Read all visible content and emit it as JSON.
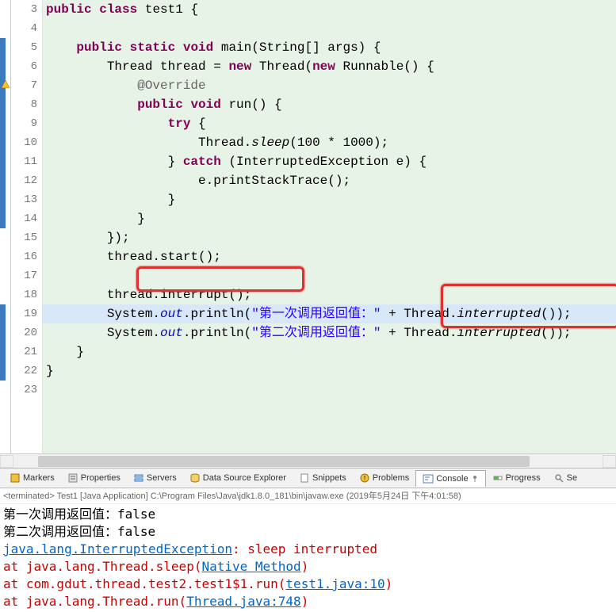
{
  "editor": {
    "lines": [
      {
        "num": 3,
        "tokens": [
          {
            "t": "public",
            "c": "kw"
          },
          {
            "t": " ",
            "c": "plain"
          },
          {
            "t": "class",
            "c": "kw"
          },
          {
            "t": " test1 {",
            "c": "plain"
          }
        ]
      },
      {
        "num": 4,
        "tokens": []
      },
      {
        "num": 5,
        "tokens": [
          {
            "t": "    ",
            "c": "plain"
          },
          {
            "t": "public",
            "c": "kw"
          },
          {
            "t": " ",
            "c": "plain"
          },
          {
            "t": "static",
            "c": "kw"
          },
          {
            "t": " ",
            "c": "plain"
          },
          {
            "t": "void",
            "c": "kw"
          },
          {
            "t": " main(String[] args) {",
            "c": "plain"
          }
        ]
      },
      {
        "num": 6,
        "tokens": [
          {
            "t": "        Thread thread = ",
            "c": "plain"
          },
          {
            "t": "new",
            "c": "kw"
          },
          {
            "t": " Thread(",
            "c": "plain"
          },
          {
            "t": "new",
            "c": "kw"
          },
          {
            "t": " Runnable() {",
            "c": "plain"
          }
        ]
      },
      {
        "num": 7,
        "tokens": [
          {
            "t": "            ",
            "c": "plain"
          },
          {
            "t": "@Override",
            "c": "ann"
          }
        ]
      },
      {
        "num": 8,
        "tokens": [
          {
            "t": "            ",
            "c": "plain"
          },
          {
            "t": "public",
            "c": "kw"
          },
          {
            "t": " ",
            "c": "plain"
          },
          {
            "t": "void",
            "c": "kw"
          },
          {
            "t": " run() {",
            "c": "plain"
          }
        ]
      },
      {
        "num": 9,
        "tokens": [
          {
            "t": "                ",
            "c": "plain"
          },
          {
            "t": "try",
            "c": "kw"
          },
          {
            "t": " {",
            "c": "plain"
          }
        ]
      },
      {
        "num": 10,
        "tokens": [
          {
            "t": "                    Thread.",
            "c": "plain"
          },
          {
            "t": "sleep",
            "c": "method-static"
          },
          {
            "t": "(100 * 1000);",
            "c": "plain"
          }
        ]
      },
      {
        "num": 11,
        "tokens": [
          {
            "t": "                } ",
            "c": "plain"
          },
          {
            "t": "catch",
            "c": "kw"
          },
          {
            "t": " (InterruptedException e) {",
            "c": "plain"
          }
        ]
      },
      {
        "num": 12,
        "tokens": [
          {
            "t": "                    e.printStackTrace();",
            "c": "plain"
          }
        ]
      },
      {
        "num": 13,
        "tokens": [
          {
            "t": "                }",
            "c": "plain"
          }
        ]
      },
      {
        "num": 14,
        "tokens": [
          {
            "t": "            }",
            "c": "plain"
          }
        ]
      },
      {
        "num": 15,
        "tokens": [
          {
            "t": "        });",
            "c": "plain"
          }
        ]
      },
      {
        "num": 16,
        "tokens": [
          {
            "t": "        thread.start();",
            "c": "plain"
          }
        ]
      },
      {
        "num": 17,
        "tokens": []
      },
      {
        "num": 18,
        "tokens": [
          {
            "t": "        thread.interrupt();",
            "c": "plain"
          }
        ]
      },
      {
        "num": 19,
        "tokens": [
          {
            "t": "        System.",
            "c": "plain"
          },
          {
            "t": "out",
            "c": "field-static"
          },
          {
            "t": ".println(",
            "c": "plain"
          },
          {
            "t": "\"第一次调用返回值：\"",
            "c": "str"
          },
          {
            "t": " + Thread.",
            "c": "plain"
          },
          {
            "t": "interrupted",
            "c": "method-static"
          },
          {
            "t": "());",
            "c": "plain"
          }
        ]
      },
      {
        "num": 20,
        "tokens": [
          {
            "t": "        System.",
            "c": "plain"
          },
          {
            "t": "out",
            "c": "field-static"
          },
          {
            "t": ".println(",
            "c": "plain"
          },
          {
            "t": "\"第二次调用返回值：\"",
            "c": "str"
          },
          {
            "t": " + Thread.",
            "c": "plain"
          },
          {
            "t": "interrupted",
            "c": "method-static"
          },
          {
            "t": "());",
            "c": "plain"
          }
        ]
      },
      {
        "num": 21,
        "tokens": [
          {
            "t": "    }",
            "c": "plain"
          }
        ]
      },
      {
        "num": 22,
        "tokens": [
          {
            "t": "}",
            "c": "plain"
          }
        ]
      },
      {
        "num": 23,
        "tokens": []
      }
    ],
    "highlight_row": 19
  },
  "tabs": {
    "items": [
      {
        "icon": "markers",
        "label": "Markers"
      },
      {
        "icon": "properties",
        "label": "Properties"
      },
      {
        "icon": "servers",
        "label": "Servers"
      },
      {
        "icon": "database",
        "label": "Data Source Explorer"
      },
      {
        "icon": "snippets",
        "label": "Snippets"
      },
      {
        "icon": "problems",
        "label": "Problems"
      },
      {
        "icon": "console",
        "label": "Console",
        "active": true,
        "pin": true
      },
      {
        "icon": "progress",
        "label": "Progress"
      },
      {
        "icon": "search",
        "label": "Se"
      }
    ]
  },
  "console": {
    "header": "<terminated> Test1 [Java Application] C:\\Program Files\\Java\\jdk1.8.0_181\\bin\\javaw.exe (2019年5月24日 下午4:01:58)",
    "lines": [
      {
        "parts": [
          {
            "t": "第一次调用返回值：false",
            "c": "plain"
          }
        ]
      },
      {
        "parts": [
          {
            "t": "第二次调用返回值：false",
            "c": "plain"
          }
        ]
      },
      {
        "parts": [
          {
            "t": "java.lang.InterruptedException",
            "c": "link"
          },
          {
            "t": ": sleep interrupted",
            "c": "err"
          }
        ]
      },
      {
        "parts": [
          {
            "t": "        at java.lang.Thread.sleep(",
            "c": "err"
          },
          {
            "t": "Native Method",
            "c": "link"
          },
          {
            "t": ")",
            "c": "err"
          }
        ]
      },
      {
        "parts": [
          {
            "t": "        at com.gdut.thread.test2.test1$1.run(",
            "c": "err"
          },
          {
            "t": "test1.java:10",
            "c": "link"
          },
          {
            "t": ")",
            "c": "err"
          }
        ]
      },
      {
        "parts": [
          {
            "t": "        at java.lang.Thread.run(",
            "c": "err"
          },
          {
            "t": "Thread.java:748",
            "c": "link"
          },
          {
            "t": ")",
            "c": "err"
          }
        ]
      }
    ]
  }
}
